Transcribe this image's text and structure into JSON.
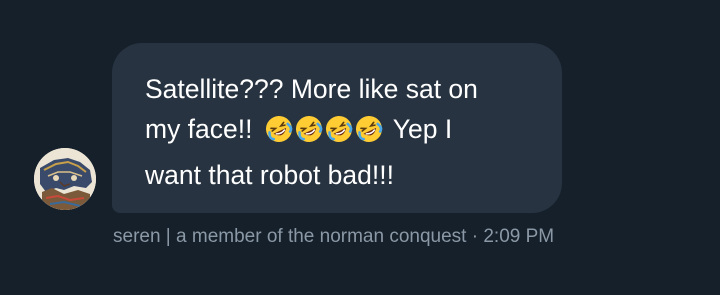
{
  "message": {
    "line1": "Satellite??? More like sat on",
    "line2_before": "my face!!",
    "line2_emojis": [
      "rolling-on-floor-laughing",
      "rolling-on-floor-laughing",
      "rolling-on-floor-laughing",
      "rolling-on-floor-laughing"
    ],
    "line2_after": "Yep I",
    "line3": "want that robot bad!!!"
  },
  "meta": {
    "sender": "seren | a member of the norman conquest",
    "separator": " · ",
    "time": "2:09 PM"
  },
  "colors": {
    "background": "#15202b",
    "bubble": "#273340",
    "text": "#ffffff",
    "meta": "#8b98a5"
  },
  "icons": {
    "avatar": "avatar-illustration",
    "emoji": "rolling-on-floor-laughing-emoji"
  }
}
